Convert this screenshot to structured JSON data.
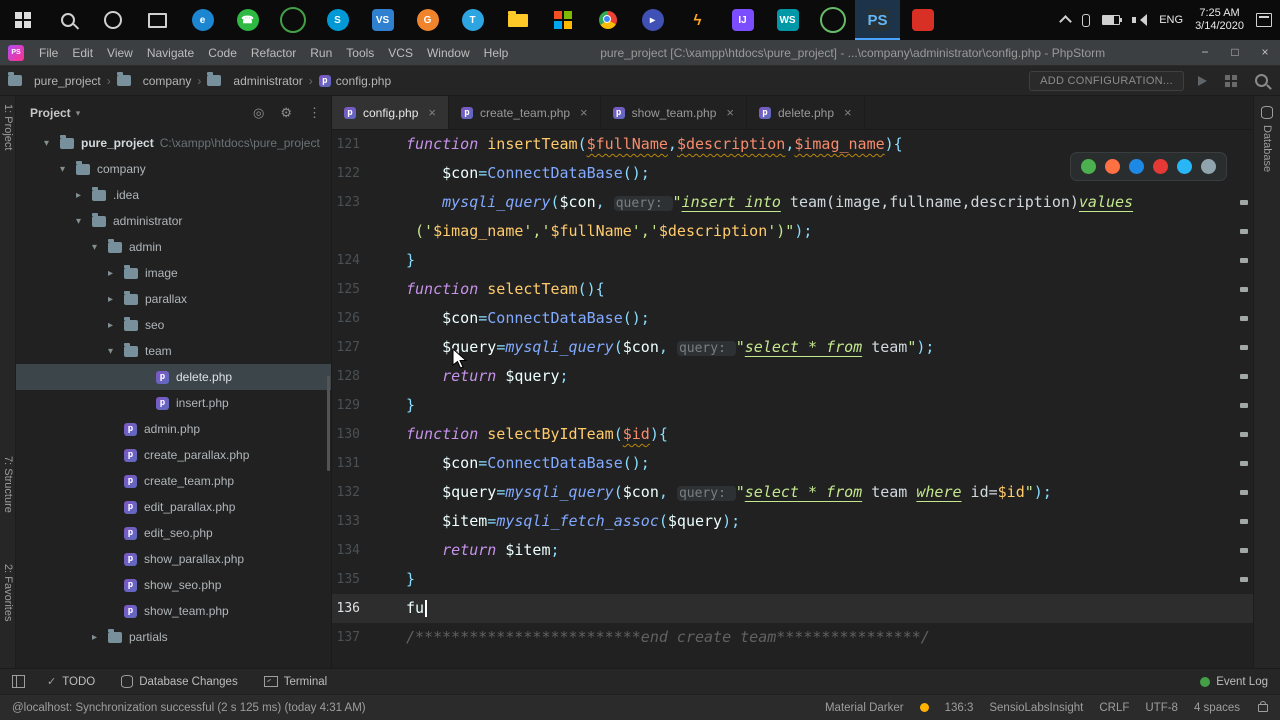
{
  "taskbar": {
    "apps": [
      {
        "name": "edge",
        "glyph": "e",
        "bg": "#1C86D1",
        "shape": "circle"
      },
      {
        "name": "whatsapp",
        "glyph": "☎",
        "bg": "#2EB943",
        "shape": "circle"
      },
      {
        "name": "greenshot",
        "glyph": "",
        "ring": "#43A047",
        "shape": "circle"
      },
      {
        "name": "skype",
        "glyph": "S",
        "bg": "#0099D6",
        "shape": "circle"
      },
      {
        "name": "vscode",
        "glyph": "VS",
        "bg": "#2F80CF",
        "shape": "square"
      },
      {
        "name": "godaddy",
        "glyph": "G",
        "bg": "#F0842C",
        "shape": "circle"
      },
      {
        "name": "telegram",
        "glyph": "T",
        "bg": "#2CA5E0",
        "shape": "circle"
      },
      {
        "name": "file-explorer",
        "kind": "folder"
      },
      {
        "name": "microsoft-store",
        "kind": "store"
      },
      {
        "name": "chrome",
        "kind": "chrome"
      },
      {
        "name": "media-player",
        "glyph": "▸",
        "bg": "#3F51B5",
        "shape": "circle"
      },
      {
        "name": "lightning-app",
        "glyph": "ϟ",
        "fg": "#FFA726",
        "shape": "square"
      },
      {
        "name": "intellij",
        "glyph": "IJ",
        "bg": "#7C4DFF",
        "shape": "square"
      },
      {
        "name": "webstorm",
        "glyph": "WS",
        "bg": "#0097A7",
        "shape": "square"
      },
      {
        "name": "android-studio",
        "glyph": "",
        "ring": "#66BB6A",
        "shape": "circle"
      },
      {
        "name": "phpstorm",
        "glyph": "PS",
        "bg": "#263238",
        "fg": "#64B5F6",
        "shape": "square",
        "active": true
      },
      {
        "name": "red-app",
        "glyph": "",
        "bg": "#D93025",
        "shape": "square"
      }
    ],
    "tray": {
      "language": "ENG",
      "time": "7:25 AM",
      "date": "3/14/2020"
    }
  },
  "menubar": {
    "logo": "PS",
    "items": [
      "File",
      "Edit",
      "View",
      "Navigate",
      "Code",
      "Refactor",
      "Run",
      "Tools",
      "VCS",
      "Window",
      "Help"
    ],
    "title": "pure_project [C:\\xampp\\htdocs\\pure_project] - ...\\company\\administrator\\config.php - PhpStorm",
    "window_controls": {
      "minimize": "−",
      "maximize": "□",
      "close": "×"
    }
  },
  "navbar": {
    "separator": "›",
    "breadcrumbs": [
      {
        "label": "pure_project",
        "icon": "folder"
      },
      {
        "label": "company",
        "icon": "folder"
      },
      {
        "label": "administrator",
        "icon": "folder"
      },
      {
        "label": "config.php",
        "icon": "php"
      }
    ],
    "add_configuration": "ADD CONFIGURATION..."
  },
  "tool_stripes": {
    "left": [
      "1: Project",
      "7: Structure",
      "2: Favorites"
    ],
    "right": [
      "Database"
    ]
  },
  "project_panel": {
    "title": "Project",
    "chevron": "▾",
    "arrow_glyphs": {
      "down": "▾",
      "right": "▸"
    },
    "header_icons": [
      {
        "name": "locate-file-icon",
        "glyph": "◎"
      },
      {
        "name": "settings-gear-icon",
        "glyph": "⚙"
      },
      {
        "name": "more-options-icon",
        "glyph": "⋮"
      }
    ],
    "tree": [
      {
        "label": "pure_project",
        "suffix": " C:\\xampp\\htdocs\\pure_project",
        "icon": "folder",
        "arrow": "down",
        "indent": 0,
        "bold": true
      },
      {
        "label": "company",
        "icon": "folder",
        "arrow": "down",
        "indent": 1
      },
      {
        "label": ".idea",
        "icon": "folder",
        "arrow": "right",
        "indent": 2
      },
      {
        "label": "administrator",
        "icon": "folder",
        "arrow": "down",
        "indent": 2
      },
      {
        "label": "admin",
        "icon": "folder",
        "arrow": "down",
        "indent": 3
      },
      {
        "label": "image",
        "icon": "folder",
        "arrow": "right",
        "indent": 4
      },
      {
        "label": "parallax",
        "icon": "folder",
        "arrow": "right",
        "indent": 4
      },
      {
        "label": "seo",
        "icon": "folder",
        "arrow": "right",
        "indent": 4
      },
      {
        "label": "team",
        "icon": "folder",
        "arrow": "down",
        "indent": 4
      },
      {
        "label": "delete.php",
        "icon": "php",
        "indent": 6,
        "selected": true
      },
      {
        "label": "insert.php",
        "icon": "php",
        "indent": 6
      },
      {
        "label": "admin.php",
        "icon": "php",
        "indent": 4
      },
      {
        "label": "create_parallax.php",
        "icon": "php",
        "indent": 4
      },
      {
        "label": "create_team.php",
        "icon": "php",
        "indent": 4
      },
      {
        "label": "edit_parallax.php",
        "icon": "php",
        "indent": 4
      },
      {
        "label": "edit_seo.php",
        "icon": "php",
        "indent": 4
      },
      {
        "label": "show_parallax.php",
        "icon": "php",
        "indent": 4
      },
      {
        "label": "show_seo.php",
        "icon": "php",
        "indent": 4
      },
      {
        "label": "show_team.php",
        "icon": "php",
        "indent": 4
      },
      {
        "label": "partials",
        "icon": "folder",
        "arrow": "right",
        "indent": 3
      }
    ]
  },
  "editor": {
    "tabs": [
      {
        "label": "config.php",
        "active": true
      },
      {
        "label": "create_team.php"
      },
      {
        "label": "show_team.php"
      },
      {
        "label": "delete.php"
      }
    ],
    "close_glyph": "×",
    "browser_popup": [
      {
        "name": "chrome-icon",
        "color": "#4CAF50"
      },
      {
        "name": "firefox-icon",
        "color": "#FF7043"
      },
      {
        "name": "edge-icon",
        "color": "#1E88E5"
      },
      {
        "name": "opera-icon",
        "color": "#E53935"
      },
      {
        "name": "safari-icon",
        "color": "#29B6F6"
      },
      {
        "name": "default-browser-icon",
        "color": "#90A4AE"
      }
    ],
    "scroll_marks": 14,
    "lines": [
      {
        "n": "121",
        "s": [
          [
            "kw",
            "function "
          ],
          [
            "fn",
            "insertTeam"
          ],
          [
            "pu",
            "("
          ],
          [
            "pa",
            "$fullName"
          ],
          [
            "pu",
            ","
          ],
          [
            "pa",
            "$description"
          ],
          [
            "pu",
            ","
          ],
          [
            "pa",
            "$imag_name"
          ],
          [
            "pu",
            "){"
          ]
        ]
      },
      {
        "n": "122",
        "s": [
          [
            "tx",
            "    "
          ],
          [
            "va",
            "$con"
          ],
          [
            "pu",
            "="
          ],
          [
            "ca",
            "ConnectDataBase"
          ],
          [
            "pu",
            "();"
          ]
        ]
      },
      {
        "n": "123",
        "s": [
          [
            "tx",
            "    "
          ],
          [
            "cai",
            "mysqli_query"
          ],
          [
            "pu",
            "("
          ],
          [
            "va",
            "$con"
          ],
          [
            "pu",
            ", "
          ],
          [
            "hint",
            "query: "
          ],
          [
            "st",
            "\""
          ],
          [
            "sq",
            "insert into"
          ],
          [
            "st",
            " "
          ],
          [
            "si",
            "team(image,fullname,description)"
          ],
          [
            "sq",
            "values"
          ]
        ]
      },
      {
        "n": "",
        "s": [
          [
            "st",
            " ('"
          ],
          [
            "sv",
            "$imag_name"
          ],
          [
            "st",
            "','"
          ],
          [
            "sv",
            "$fullName"
          ],
          [
            "st",
            "','"
          ],
          [
            "sv",
            "$description"
          ],
          [
            "st",
            "')\""
          ],
          [
            "pu",
            ");"
          ]
        ]
      },
      {
        "n": "124",
        "s": [
          [
            "pu",
            "}"
          ]
        ]
      },
      {
        "n": "125",
        "s": [
          [
            "kw",
            "function "
          ],
          [
            "fn",
            "selectTeam"
          ],
          [
            "pu",
            "(){"
          ]
        ]
      },
      {
        "n": "126",
        "s": [
          [
            "tx",
            "    "
          ],
          [
            "va",
            "$con"
          ],
          [
            "pu",
            "="
          ],
          [
            "ca",
            "ConnectDataBase"
          ],
          [
            "pu",
            "();"
          ]
        ]
      },
      {
        "n": "127",
        "s": [
          [
            "tx",
            "    "
          ],
          [
            "va",
            "$query"
          ],
          [
            "pu",
            "="
          ],
          [
            "cai",
            "mysqli_query"
          ],
          [
            "pu",
            "("
          ],
          [
            "va",
            "$con"
          ],
          [
            "pu",
            ", "
          ],
          [
            "hint",
            "query: "
          ],
          [
            "st",
            "\""
          ],
          [
            "sq",
            "select * from"
          ],
          [
            "st",
            " "
          ],
          [
            "si",
            "team"
          ],
          [
            "st",
            "\""
          ],
          [
            "pu",
            ");"
          ]
        ]
      },
      {
        "n": "128",
        "s": [
          [
            "tx",
            "    "
          ],
          [
            "kw",
            "return "
          ],
          [
            "va",
            "$query"
          ],
          [
            "pu",
            ";"
          ]
        ]
      },
      {
        "n": "129",
        "s": [
          [
            "pu",
            "}"
          ]
        ]
      },
      {
        "n": "130",
        "s": [
          [
            "kw",
            "function "
          ],
          [
            "fn",
            "selectByIdTeam"
          ],
          [
            "pu",
            "("
          ],
          [
            "pa",
            "$id"
          ],
          [
            "pu",
            "){"
          ]
        ]
      },
      {
        "n": "131",
        "s": [
          [
            "tx",
            "    "
          ],
          [
            "va",
            "$con"
          ],
          [
            "pu",
            "="
          ],
          [
            "ca",
            "ConnectDataBase"
          ],
          [
            "pu",
            "();"
          ]
        ]
      },
      {
        "n": "132",
        "s": [
          [
            "tx",
            "    "
          ],
          [
            "va",
            "$query"
          ],
          [
            "pu",
            "="
          ],
          [
            "cai",
            "mysqli_query"
          ],
          [
            "pu",
            "("
          ],
          [
            "va",
            "$con"
          ],
          [
            "pu",
            ", "
          ],
          [
            "hint",
            "query: "
          ],
          [
            "st",
            "\""
          ],
          [
            "sq",
            "select * from"
          ],
          [
            "st",
            " "
          ],
          [
            "si",
            "team"
          ],
          [
            "st",
            " "
          ],
          [
            "sq",
            "where"
          ],
          [
            "st",
            " "
          ],
          [
            "si",
            "id="
          ],
          [
            "sv",
            "$id"
          ],
          [
            "st",
            "\""
          ],
          [
            "pu",
            ");"
          ]
        ]
      },
      {
        "n": "133",
        "s": [
          [
            "tx",
            "    "
          ],
          [
            "va",
            "$item"
          ],
          [
            "pu",
            "="
          ],
          [
            "cai",
            "mysqli_fetch_assoc"
          ],
          [
            "pu",
            "("
          ],
          [
            "va",
            "$query"
          ],
          [
            "pu",
            ");"
          ]
        ]
      },
      {
        "n": "134",
        "s": [
          [
            "tx",
            "    "
          ],
          [
            "kw",
            "return "
          ],
          [
            "va",
            "$item"
          ],
          [
            "pu",
            ";"
          ]
        ]
      },
      {
        "n": "135",
        "s": [
          [
            "pu",
            "}"
          ]
        ]
      },
      {
        "n": "136",
        "c": true,
        "s": [
          [
            "tx",
            "fu"
          ],
          [
            "caret",
            ""
          ]
        ]
      },
      {
        "n": "137",
        "s": [
          [
            "cm",
            "/*************************end create team****************/"
          ]
        ]
      }
    ]
  },
  "bottom_bar": {
    "left": [
      {
        "label": "TODO",
        "icon": "todo"
      },
      {
        "label": "Database Changes",
        "icon": "db"
      },
      {
        "label": "Terminal",
        "icon": "terminal"
      }
    ],
    "right": [
      {
        "label": "Event Log"
      }
    ]
  },
  "status_bar": {
    "message": "@localhost: Synchronization successful (2 s 125 ms)  (today 4:31 AM)",
    "theme": "Material Darker",
    "items": [
      "136:3",
      "SensioLabsInsight",
      "CRLF",
      "UTF-8",
      "4 spaces"
    ]
  }
}
